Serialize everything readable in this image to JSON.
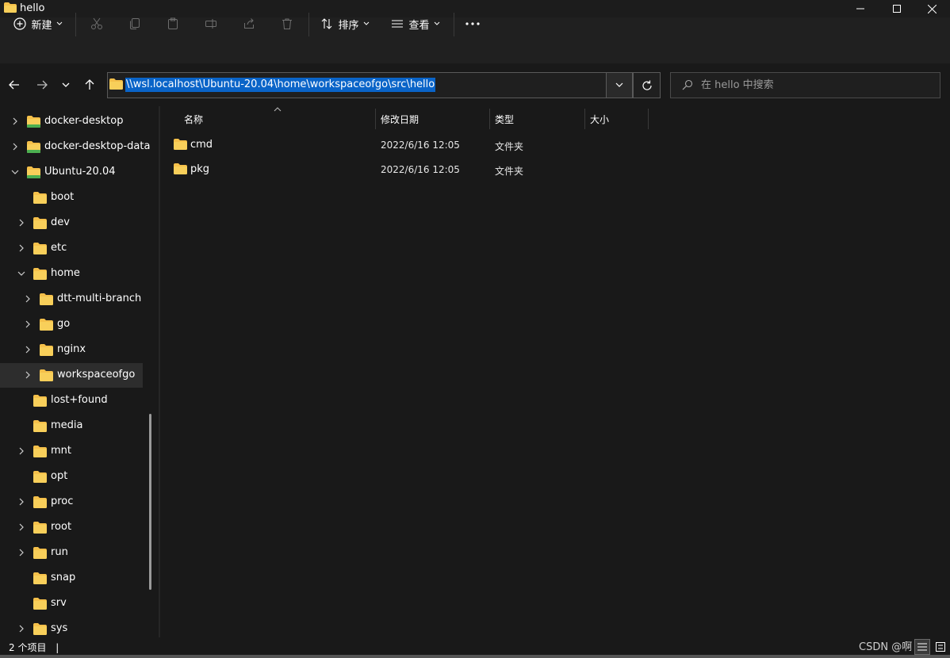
{
  "window": {
    "title": "hello",
    "accent_color": "#0a64c8",
    "background_color": "#191919",
    "folder_color": "#f5c04a"
  },
  "toolbar": {
    "new_label": "新建",
    "sort_label": "排序",
    "view_label": "查看",
    "icons": [
      "cut-icon",
      "copy-icon",
      "paste-icon",
      "rename-icon",
      "share-icon",
      "delete-icon",
      "more-icon"
    ]
  },
  "address": {
    "path": "\\\\wsl.localhost\\Ubuntu-20.04\\home\\workspaceofgo\\src\\hello"
  },
  "search": {
    "placeholder": "在 hello 中搜索"
  },
  "sidebar": {
    "items": [
      {
        "label": "docker-desktop",
        "level": 0,
        "expander": "collapsed"
      },
      {
        "label": "docker-desktop-data",
        "level": 0,
        "expander": "collapsed"
      },
      {
        "label": "Ubuntu-20.04",
        "level": 0,
        "expander": "expanded"
      },
      {
        "label": "boot",
        "level": 1,
        "expander": "none"
      },
      {
        "label": "dev",
        "level": 1,
        "expander": "collapsed"
      },
      {
        "label": "etc",
        "level": 1,
        "expander": "collapsed"
      },
      {
        "label": "home",
        "level": 1,
        "expander": "expanded"
      },
      {
        "label": "dtt-multi-branch",
        "level": 2,
        "expander": "collapsed"
      },
      {
        "label": "go",
        "level": 2,
        "expander": "collapsed"
      },
      {
        "label": "nginx",
        "level": 2,
        "expander": "collapsed"
      },
      {
        "label": "workspaceofgo",
        "level": 2,
        "expander": "collapsed",
        "selected": true
      },
      {
        "label": "lost+found",
        "level": 1,
        "expander": "none"
      },
      {
        "label": "media",
        "level": 1,
        "expander": "none"
      },
      {
        "label": "mnt",
        "level": 1,
        "expander": "collapsed"
      },
      {
        "label": "opt",
        "level": 1,
        "expander": "none"
      },
      {
        "label": "proc",
        "level": 1,
        "expander": "collapsed"
      },
      {
        "label": "root",
        "level": 1,
        "expander": "collapsed"
      },
      {
        "label": "run",
        "level": 1,
        "expander": "collapsed"
      },
      {
        "label": "snap",
        "level": 1,
        "expander": "none"
      },
      {
        "label": "srv",
        "level": 1,
        "expander": "none"
      },
      {
        "label": "sys",
        "level": 1,
        "expander": "collapsed"
      }
    ]
  },
  "filelist": {
    "columns": {
      "name": "名称",
      "date": "修改日期",
      "type": "类型",
      "size": "大小"
    },
    "rows": [
      {
        "name": "cmd",
        "date": "2022/6/16 12:05",
        "type": "文件夹",
        "size": ""
      },
      {
        "name": "pkg",
        "date": "2022/6/16 12:05",
        "type": "文件夹",
        "size": ""
      }
    ]
  },
  "status": {
    "item_count": "2 个项目",
    "separator": "|",
    "watermark": "CSDN @啊"
  }
}
